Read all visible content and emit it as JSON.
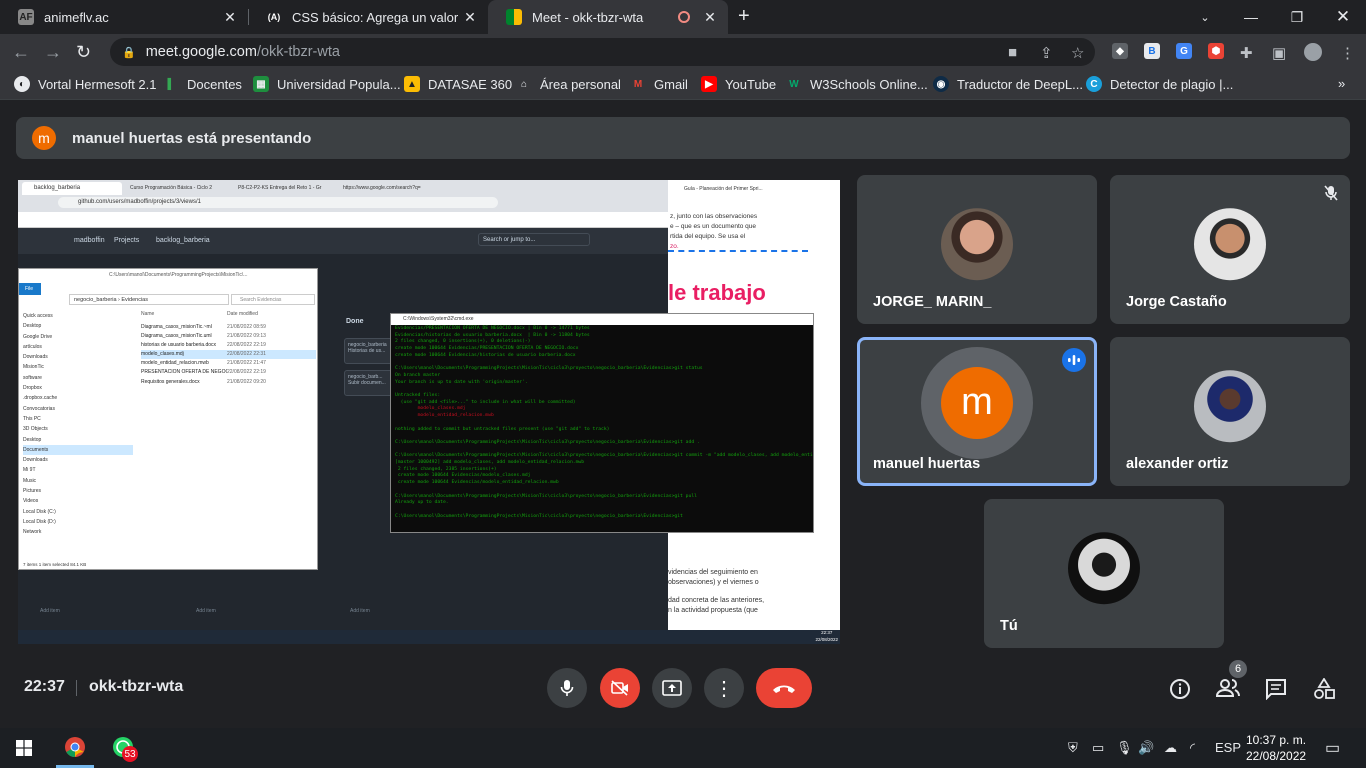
{
  "tabs": [
    {
      "title": "animeflv.ac",
      "favicon": "AF"
    },
    {
      "title": "CSS básico: Agrega un valor de r",
      "favicon": "(A)"
    },
    {
      "title": "Meet - okk-tbzr-wta",
      "favicon": "M"
    }
  ],
  "address": {
    "host": "meet.google.com",
    "path": "/okk-tbzr-wta"
  },
  "bookmarks": [
    "Vortal Hermesoft 2.1",
    "Docentes",
    "Universidad Popula...",
    "DATASAE 360",
    "Área personal",
    "Gmail",
    "YouTube",
    "W3Schools Online...",
    "Traductor de DeepL...",
    "Detector de plagio |..."
  ],
  "banner": {
    "initial": "m",
    "text": "manuel huertas está presentando"
  },
  "shared_screen": {
    "tabs": [
      "backlog_barberia",
      "Curso Programación Básica - Ciclo 2",
      "P8-C2-P2-KS Entrega del Reto 1 - Gr",
      "https://www.google.com/search?q="
    ],
    "url": "github.com/users/madboffin/projects/3/views/1",
    "breadcrumb": [
      "madboffin",
      "Projects",
      "backlog_barberia"
    ],
    "search": "Search or jump to...",
    "doc_heading": "le trabajo",
    "explorer": {
      "path": "negocio_barberia › Evidencias",
      "search_placeholder": "Search Evidencias",
      "cols": [
        "Name",
        "Date modified"
      ],
      "files": [
        [
          "Diagrama_casos_misionTic.~ml",
          "21/08/2022 08:59"
        ],
        [
          "Diagrama_casos_misionTic.uml",
          "21/08/2022 09:13"
        ],
        [
          "historias de usuario barberia.docx",
          "22/08/2022 22:19"
        ],
        [
          "modelo_clases.mdj",
          "22/08/2022 22:31"
        ],
        [
          "modelo_entidad_relacion.mwb",
          "21/08/2022 21:47"
        ],
        [
          "PRESENTACION OFERTA DE NEGOCIO.do...",
          "22/08/2022 22:19"
        ],
        [
          "Requisitos generales.docx",
          "21/08/2022 09:20"
        ]
      ],
      "nav": [
        "Quick access",
        "Desktop",
        "Google Drive",
        "artículos",
        "Downloads",
        "MisionTic",
        "software",
        "Dropbox",
        ".dropbox.cache",
        "Convocatorias",
        "This PC",
        "3D Objects",
        "Desktop",
        "Documents",
        "Downloads",
        "Mi 9T",
        "Music",
        "Pictures",
        "Videos",
        "Local Disk (C:)",
        "Local Disk (D:)",
        "Network"
      ],
      "status": "7 items   1 item selected  84.1 KB"
    },
    "cmd_title": "C:\\Windows\\System32\\cmd.exe",
    "cmd_lines": [
      "Evidencias/PRESENTACION OFERTA DE NEGOCIO.docx | Bin 0 -> 14771 bytes",
      "Evidencias/historias de usuario barberia.docx  | Bin 0 -> 11804 bytes",
      "2 files changed, 0 insertions(+), 0 deletions(-)",
      "create mode 100644 Evidencias/PRESENTACION OFERTA DE NEGOCIO.docx",
      "create mode 100644 Evidencias/historias de usuario barberia.docx",
      "",
      "C:\\Users\\manol\\Documents\\ProgrammingProjects\\MisionTic\\ciclo3\\proyecto\\negocio_barberia\\Evidencias>git status",
      "On branch master",
      "Your branch is up to date with 'origin/master'.",
      "",
      "Untracked files:",
      "  (use \"git add <file>...\" to include in what will be committed)",
      "        modelo_clases.mdj",
      "        modelo_entidad_relacion.mwb",
      "",
      "nothing added to commit but untracked files present (use \"git add\" to track)",
      "",
      "C:\\Users\\manol\\Documents\\ProgrammingProjects\\MisionTic\\ciclo3\\proyecto\\negocio_barberia\\Evidencias>git add .",
      "",
      "C:\\Users\\manol\\Documents\\ProgrammingProjects\\MisionTic\\ciclo3\\proyecto\\negocio_barberia\\Evidencias>git commit -m \"add modelo_clases, add modelo_entidad_relacion.mwb\"",
      "[master 1000492] add modelo_clases, add modelo_entidad_relacion.mwb",
      " 2 files changed, 2385 insertions(+)",
      " create mode 100644 Evidencias/modelo_clases.mdj",
      " create mode 100644 Evidencias/modelo_entidad_relacion.mwb",
      "",
      "C:\\Users\\manol\\Documents\\ProgrammingProjects\\MisionTic\\ciclo3\\proyecto\\negocio_barberia\\Evidencias>git pull",
      "Already up to date.",
      "",
      "C:\\Users\\manol\\Documents\\ProgrammingProjects\\MisionTic\\ciclo3\\proyecto\\negocio_barberia\\Evidencias>git"
    ],
    "board": {
      "col": "Done",
      "cards": [
        "negocio_barberia",
        "Historias de us...",
        "negocio_barb...",
        "Subir documen..."
      ],
      "add": "Add item"
    },
    "doc_snippets": [
      "z, junto con las observaciones",
      "e – que es un documento que",
      "rtida del equipo. Se usa el",
      "zo.",
      "videncias del seguimiento en",
      "observaciones) y el viernes o",
      "dad concreta de las anteriores,",
      "n la actividad propuesta (que"
    ],
    "inner_clock": [
      "22:37",
      "22/08/2022"
    ],
    "doc_tab": "Guía - Planeación del Primer Spri..."
  },
  "participants": [
    {
      "name": "JORGE_ MARIN_",
      "muted": false
    },
    {
      "name": "Jorge Castaño",
      "muted": true
    },
    {
      "name": "manuel huertas",
      "initial": "m",
      "speaking": true
    },
    {
      "name": "alexander ortiz"
    },
    {
      "name": "Tú"
    }
  ],
  "bottom": {
    "time": "22:37",
    "code": "okk-tbzr-wta",
    "people_count": "6"
  },
  "taskbar": {
    "whatsapp_badge": "53",
    "lang": "ESP",
    "time": "10:37 p. m.",
    "date": "22/08/2022"
  },
  "colors": {
    "accent": "#8ab4f8",
    "danger": "#ea4335",
    "avatar": "#ef6c00"
  }
}
